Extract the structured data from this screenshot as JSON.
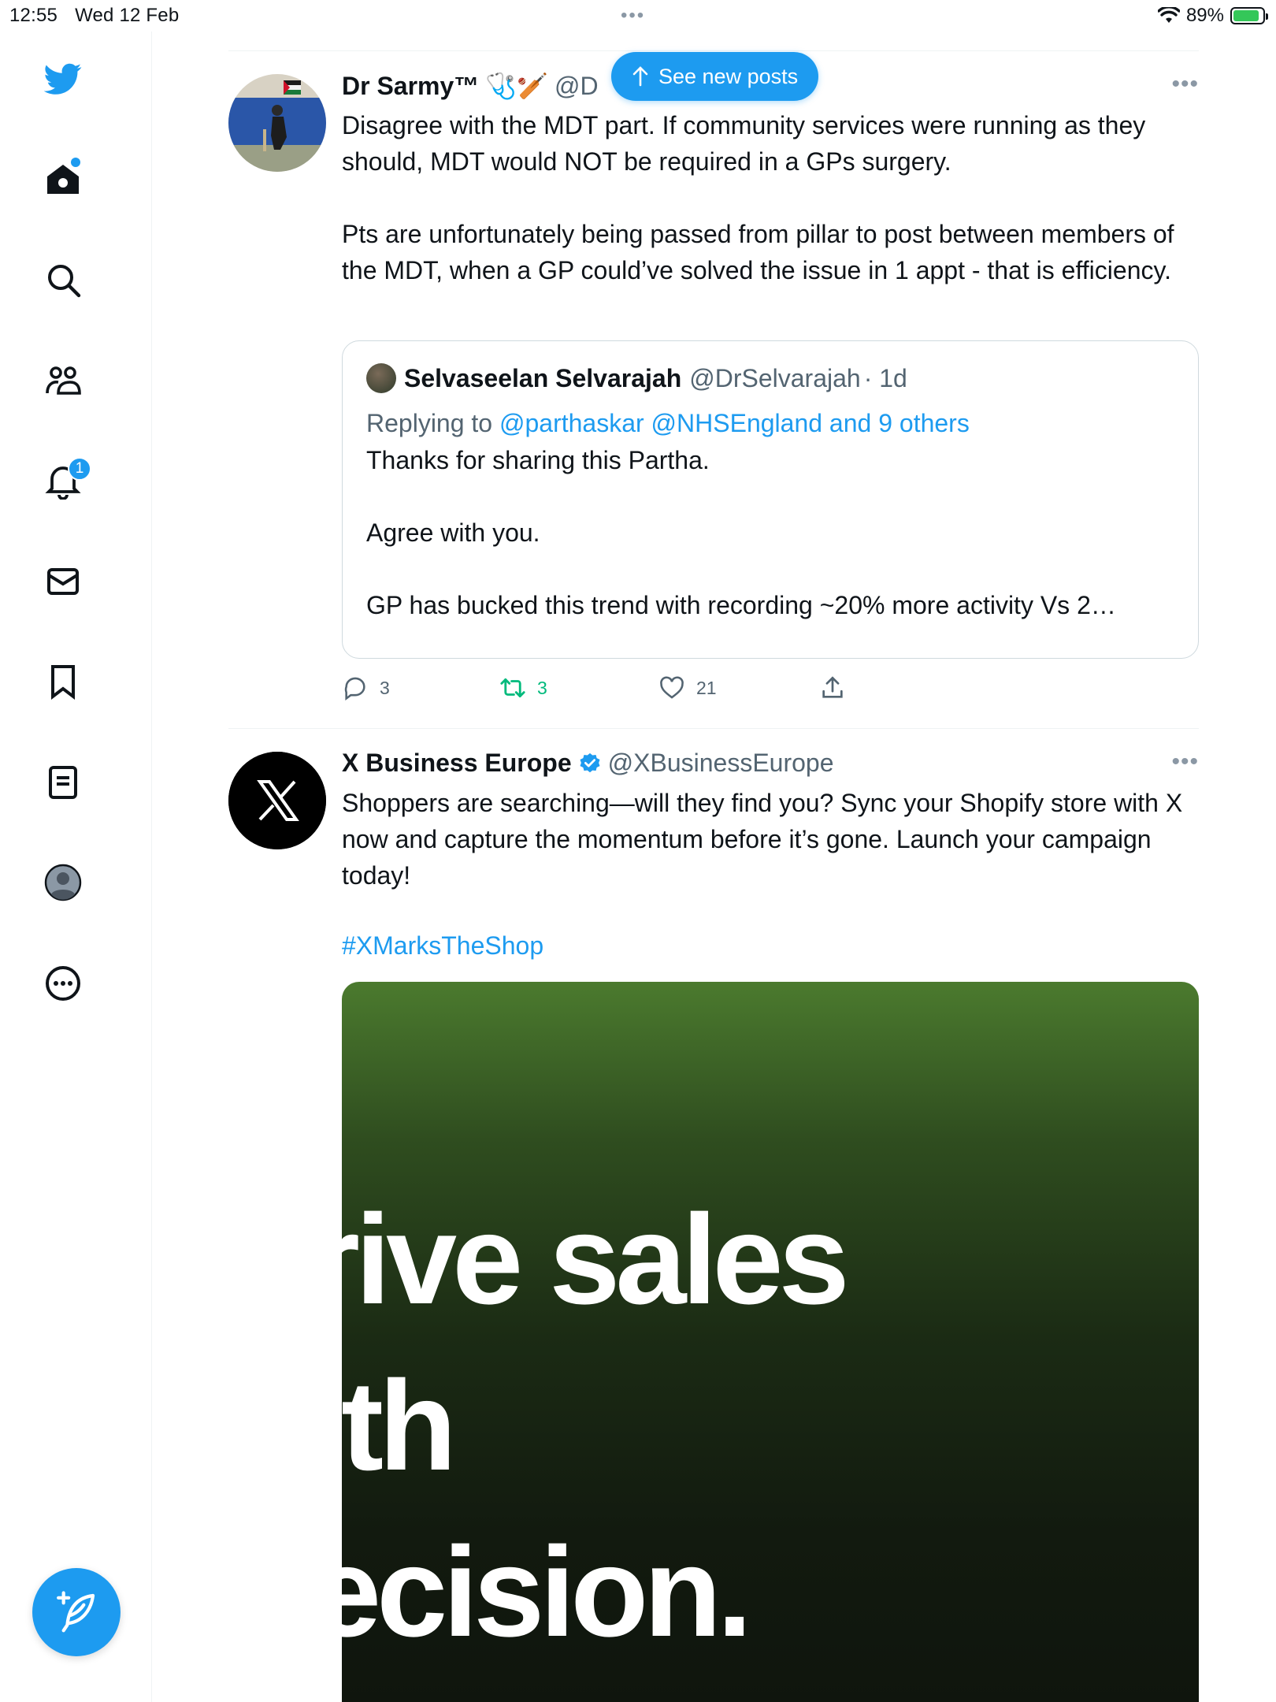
{
  "status_bar": {
    "time": "12:55",
    "date": "Wed 12 Feb",
    "battery": "89%",
    "battery_level": 0.89
  },
  "sidebar": {
    "notification_count": "1",
    "icons": [
      "twitter-bird-icon",
      "home-icon",
      "search-icon",
      "communities-icon",
      "notifications-icon",
      "messages-icon",
      "bookmarks-icon",
      "lists-icon",
      "profile-icon",
      "more-icon",
      "compose-icon"
    ],
    "brand_color": "#1d9bf0"
  },
  "new_posts_button": {
    "label": "See new posts"
  },
  "tweets": [
    {
      "name": "Dr Sarmy™",
      "name_emojis": "🩺🏏",
      "handle": "@D",
      "text": "Disagree with the MDT part. If community services were running as they should, MDT would NOT be required in a GPs surgery.\n\nPts are unfortunately being passed from pillar to post between members of the MDT, when a GP could’ve solved the issue in 1 appt - that is efficiency.",
      "quote": {
        "name": "Selvaseelan Selvarajah",
        "handle": "@DrSelvarajah",
        "time": "· 1d",
        "replying_prefix": "Replying to",
        "replying_to": "@parthaskar @NHSEngland and 9 others",
        "text": "Thanks for sharing this Partha.\n\nAgree with you.\n\nGP has bucked this trend with recording ~20% more activity Vs 2…"
      },
      "replies": "3",
      "reposts": "3",
      "likes": "21"
    },
    {
      "name": "X Business Europe",
      "handle": "@XBusinessEurope",
      "verified": true,
      "text": "Shoppers are searching—will they find you? Sync your Shopify store with X now and capture the momentum before it’s gone. Launch your campaign today!",
      "hashtag": "#XMarksTheShop",
      "media_lines": [
        "rive sales",
        "ith",
        "ecision."
      ]
    }
  ]
}
